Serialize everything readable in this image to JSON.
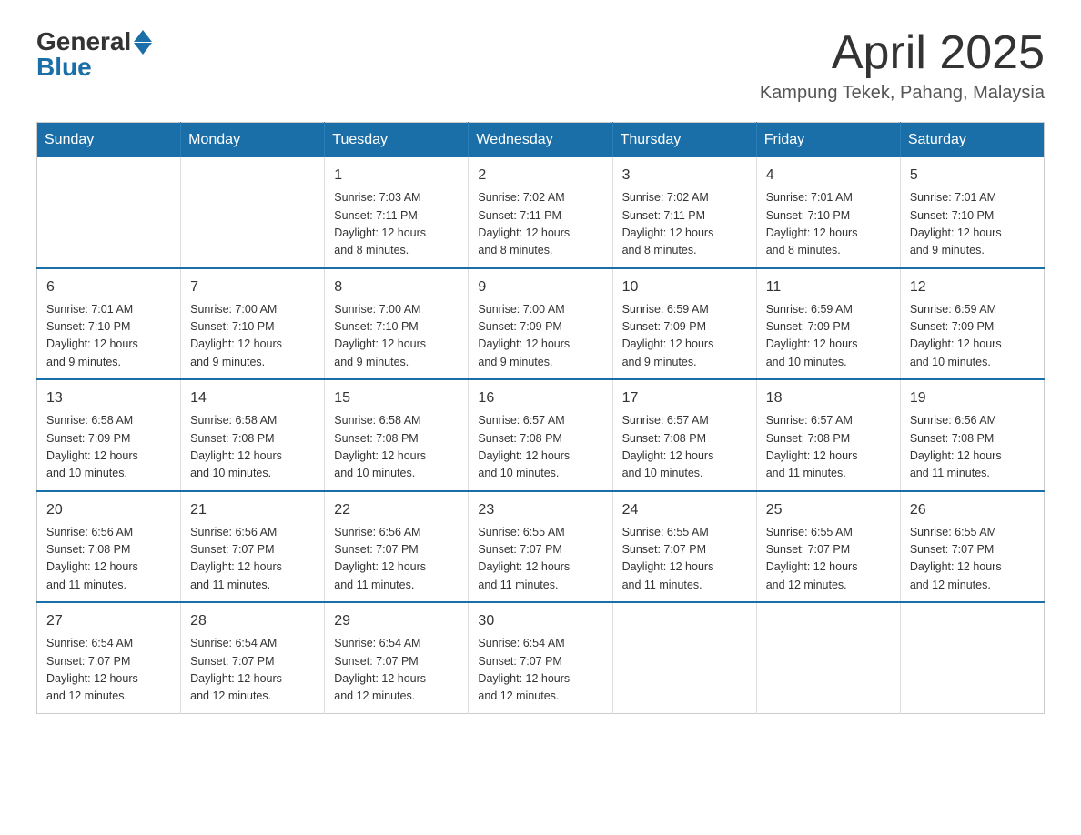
{
  "header": {
    "logo_general": "General",
    "logo_blue": "Blue",
    "month": "April 2025",
    "location": "Kampung Tekek, Pahang, Malaysia"
  },
  "days_of_week": [
    "Sunday",
    "Monday",
    "Tuesday",
    "Wednesday",
    "Thursday",
    "Friday",
    "Saturday"
  ],
  "weeks": [
    [
      {
        "day": "",
        "info": ""
      },
      {
        "day": "",
        "info": ""
      },
      {
        "day": "1",
        "info": "Sunrise: 7:03 AM\nSunset: 7:11 PM\nDaylight: 12 hours\nand 8 minutes."
      },
      {
        "day": "2",
        "info": "Sunrise: 7:02 AM\nSunset: 7:11 PM\nDaylight: 12 hours\nand 8 minutes."
      },
      {
        "day": "3",
        "info": "Sunrise: 7:02 AM\nSunset: 7:11 PM\nDaylight: 12 hours\nand 8 minutes."
      },
      {
        "day": "4",
        "info": "Sunrise: 7:01 AM\nSunset: 7:10 PM\nDaylight: 12 hours\nand 8 minutes."
      },
      {
        "day": "5",
        "info": "Sunrise: 7:01 AM\nSunset: 7:10 PM\nDaylight: 12 hours\nand 9 minutes."
      }
    ],
    [
      {
        "day": "6",
        "info": "Sunrise: 7:01 AM\nSunset: 7:10 PM\nDaylight: 12 hours\nand 9 minutes."
      },
      {
        "day": "7",
        "info": "Sunrise: 7:00 AM\nSunset: 7:10 PM\nDaylight: 12 hours\nand 9 minutes."
      },
      {
        "day": "8",
        "info": "Sunrise: 7:00 AM\nSunset: 7:10 PM\nDaylight: 12 hours\nand 9 minutes."
      },
      {
        "day": "9",
        "info": "Sunrise: 7:00 AM\nSunset: 7:09 PM\nDaylight: 12 hours\nand 9 minutes."
      },
      {
        "day": "10",
        "info": "Sunrise: 6:59 AM\nSunset: 7:09 PM\nDaylight: 12 hours\nand 9 minutes."
      },
      {
        "day": "11",
        "info": "Sunrise: 6:59 AM\nSunset: 7:09 PM\nDaylight: 12 hours\nand 10 minutes."
      },
      {
        "day": "12",
        "info": "Sunrise: 6:59 AM\nSunset: 7:09 PM\nDaylight: 12 hours\nand 10 minutes."
      }
    ],
    [
      {
        "day": "13",
        "info": "Sunrise: 6:58 AM\nSunset: 7:09 PM\nDaylight: 12 hours\nand 10 minutes."
      },
      {
        "day": "14",
        "info": "Sunrise: 6:58 AM\nSunset: 7:08 PM\nDaylight: 12 hours\nand 10 minutes."
      },
      {
        "day": "15",
        "info": "Sunrise: 6:58 AM\nSunset: 7:08 PM\nDaylight: 12 hours\nand 10 minutes."
      },
      {
        "day": "16",
        "info": "Sunrise: 6:57 AM\nSunset: 7:08 PM\nDaylight: 12 hours\nand 10 minutes."
      },
      {
        "day": "17",
        "info": "Sunrise: 6:57 AM\nSunset: 7:08 PM\nDaylight: 12 hours\nand 10 minutes."
      },
      {
        "day": "18",
        "info": "Sunrise: 6:57 AM\nSunset: 7:08 PM\nDaylight: 12 hours\nand 11 minutes."
      },
      {
        "day": "19",
        "info": "Sunrise: 6:56 AM\nSunset: 7:08 PM\nDaylight: 12 hours\nand 11 minutes."
      }
    ],
    [
      {
        "day": "20",
        "info": "Sunrise: 6:56 AM\nSunset: 7:08 PM\nDaylight: 12 hours\nand 11 minutes."
      },
      {
        "day": "21",
        "info": "Sunrise: 6:56 AM\nSunset: 7:07 PM\nDaylight: 12 hours\nand 11 minutes."
      },
      {
        "day": "22",
        "info": "Sunrise: 6:56 AM\nSunset: 7:07 PM\nDaylight: 12 hours\nand 11 minutes."
      },
      {
        "day": "23",
        "info": "Sunrise: 6:55 AM\nSunset: 7:07 PM\nDaylight: 12 hours\nand 11 minutes."
      },
      {
        "day": "24",
        "info": "Sunrise: 6:55 AM\nSunset: 7:07 PM\nDaylight: 12 hours\nand 11 minutes."
      },
      {
        "day": "25",
        "info": "Sunrise: 6:55 AM\nSunset: 7:07 PM\nDaylight: 12 hours\nand 12 minutes."
      },
      {
        "day": "26",
        "info": "Sunrise: 6:55 AM\nSunset: 7:07 PM\nDaylight: 12 hours\nand 12 minutes."
      }
    ],
    [
      {
        "day": "27",
        "info": "Sunrise: 6:54 AM\nSunset: 7:07 PM\nDaylight: 12 hours\nand 12 minutes."
      },
      {
        "day": "28",
        "info": "Sunrise: 6:54 AM\nSunset: 7:07 PM\nDaylight: 12 hours\nand 12 minutes."
      },
      {
        "day": "29",
        "info": "Sunrise: 6:54 AM\nSunset: 7:07 PM\nDaylight: 12 hours\nand 12 minutes."
      },
      {
        "day": "30",
        "info": "Sunrise: 6:54 AM\nSunset: 7:07 PM\nDaylight: 12 hours\nand 12 minutes."
      },
      {
        "day": "",
        "info": ""
      },
      {
        "day": "",
        "info": ""
      },
      {
        "day": "",
        "info": ""
      }
    ]
  ]
}
